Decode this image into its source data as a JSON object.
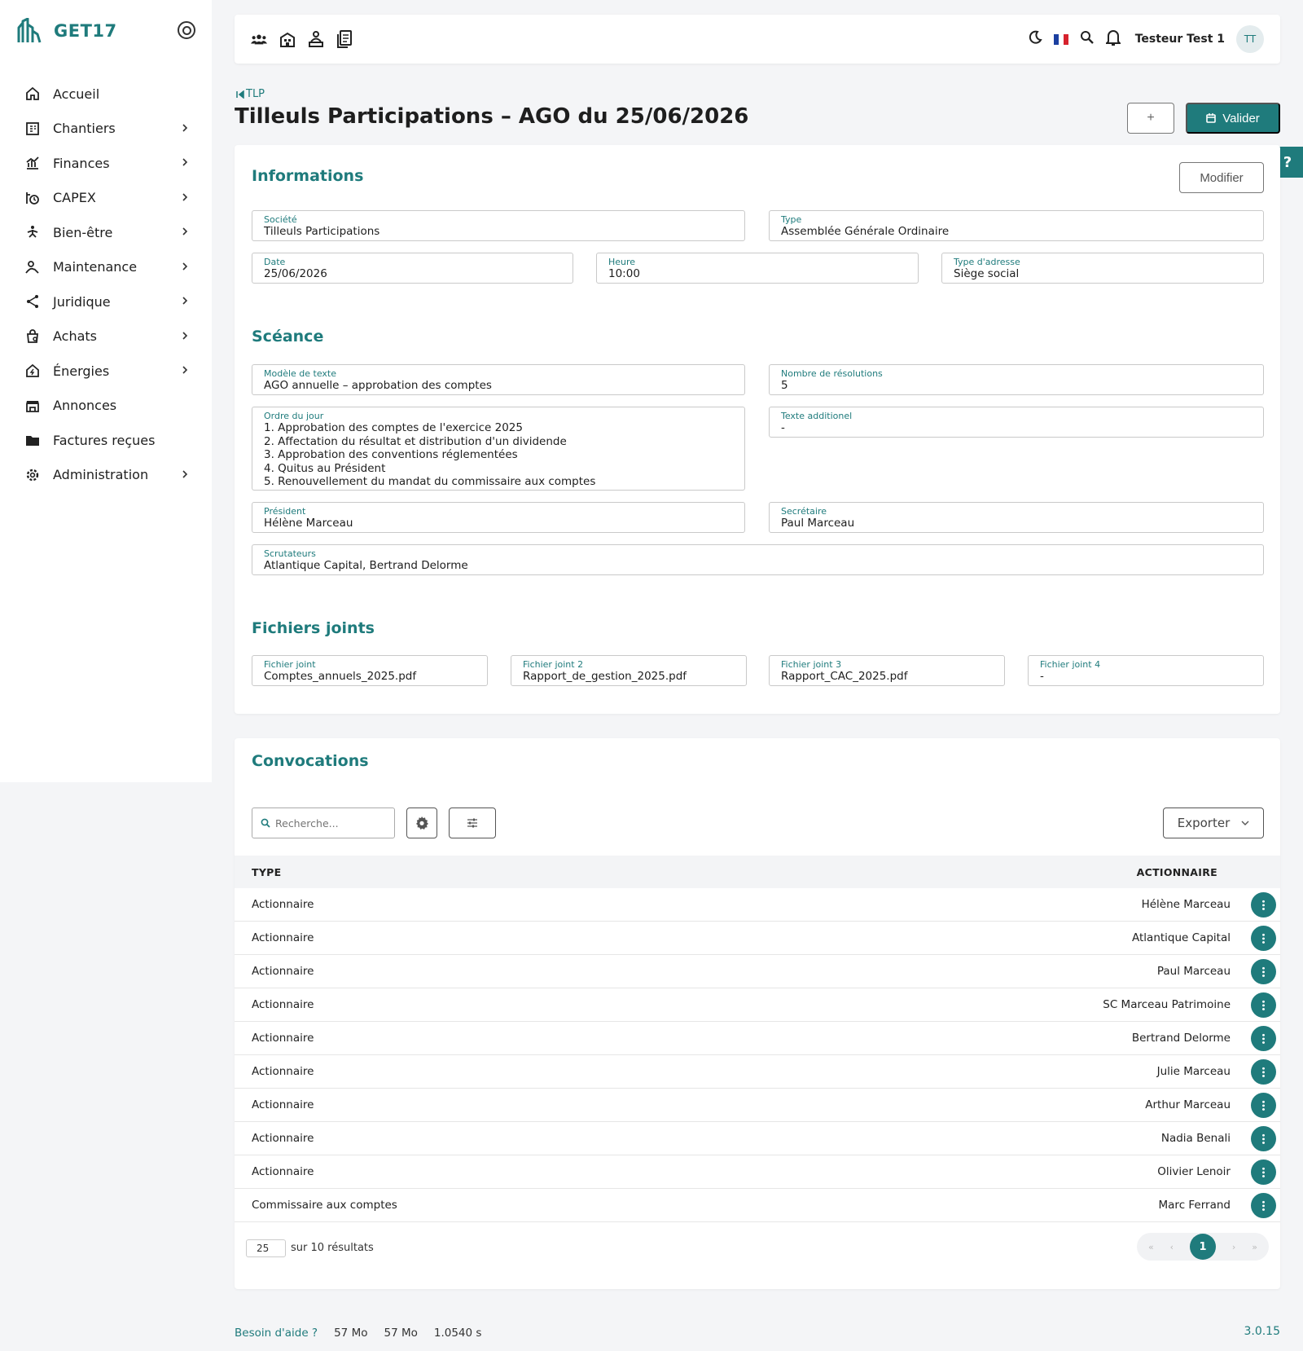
{
  "brand": {
    "name": "GET17"
  },
  "sidebar": {
    "items": [
      {
        "label": "Accueil",
        "icon": "home-icon",
        "chevron": false
      },
      {
        "label": "Chantiers",
        "icon": "building-plan-icon",
        "chevron": true
      },
      {
        "label": "Finances",
        "icon": "finance-chart-icon",
        "chevron": true
      },
      {
        "label": "CAPEX",
        "icon": "capex-icon",
        "chevron": true
      },
      {
        "label": "Bien-être",
        "icon": "wellness-icon",
        "chevron": true
      },
      {
        "label": "Maintenance",
        "icon": "maintenance-icon",
        "chevron": true
      },
      {
        "label": "Juridique",
        "icon": "share-icon",
        "chevron": true
      },
      {
        "label": "Achats",
        "icon": "shopping-icon",
        "chevron": true
      },
      {
        "label": "Énergies",
        "icon": "energy-home-icon",
        "chevron": true
      },
      {
        "label": "Annonces",
        "icon": "storefront-icon",
        "chevron": false
      },
      {
        "label": "Factures reçues",
        "icon": "folder-icon",
        "chevron": false
      },
      {
        "label": "Administration",
        "icon": "settings-icon",
        "chevron": true
      }
    ]
  },
  "topbar": {
    "user_name": "Testeur Test 1",
    "avatar_initials": "TT"
  },
  "breadcrumb": {
    "label": "TLP"
  },
  "page": {
    "title": "Tilleuls Participations – AGO du 25/06/2026",
    "plus_label": "+",
    "valider_label": "Valider",
    "help_label": "?"
  },
  "informations": {
    "title": "Informations",
    "modifier_label": "Modifier",
    "societe": {
      "label": "Société",
      "value": "Tilleuls Participations"
    },
    "type": {
      "label": "Type",
      "value": "Assemblée Générale Ordinaire"
    },
    "date": {
      "label": "Date",
      "value": "25/06/2026"
    },
    "heure": {
      "label": "Heure",
      "value": "10:00"
    },
    "type_adresse": {
      "label": "Type d'adresse",
      "value": "Siège social"
    }
  },
  "seance": {
    "title": "Scéance",
    "modele": {
      "label": "Modèle de texte",
      "value": "AGO annuelle – approbation des comptes"
    },
    "nb_resolutions": {
      "label": "Nombre de résolutions",
      "value": "5"
    },
    "ordre_du_jour": {
      "label": "Ordre du jour",
      "value": "1. Approbation des comptes de l'exercice 2025\n2. Affectation du résultat et distribution d'un dividende\n3. Approbation des conventions réglementées\n4. Quitus au Président\n5. Renouvellement du mandat du commissaire aux comptes"
    },
    "texte_additionnel": {
      "label": "Texte additionel",
      "value": "-"
    },
    "president": {
      "label": "Président",
      "value": "Hélène Marceau"
    },
    "secretaire": {
      "label": "Secrétaire",
      "value": "Paul Marceau"
    },
    "scrutateurs": {
      "label": "Scrutateurs",
      "value": "Atlantique Capital, Bertrand Delorme"
    }
  },
  "fichiers": {
    "title": "Fichiers joints",
    "items": [
      {
        "label": "Fichier joint",
        "value": "Comptes_annuels_2025.pdf"
      },
      {
        "label": "Fichier joint 2",
        "value": "Rapport_de_gestion_2025.pdf"
      },
      {
        "label": "Fichier joint 3",
        "value": "Rapport_CAC_2025.pdf"
      },
      {
        "label": "Fichier joint 4",
        "value": "-"
      }
    ]
  },
  "convocations": {
    "title": "Convocations",
    "search_placeholder": "Recherche...",
    "export_label": "Exporter",
    "columns": {
      "type": "TYPE",
      "actionnaire": "ACTIONNAIRE"
    },
    "rows": [
      {
        "type": "Actionnaire",
        "name": "Hélène Marceau"
      },
      {
        "type": "Actionnaire",
        "name": "Atlantique Capital"
      },
      {
        "type": "Actionnaire",
        "name": "Paul Marceau"
      },
      {
        "type": "Actionnaire",
        "name": "SC Marceau Patrimoine"
      },
      {
        "type": "Actionnaire",
        "name": "Bertrand Delorme"
      },
      {
        "type": "Actionnaire",
        "name": "Julie Marceau"
      },
      {
        "type": "Actionnaire",
        "name": "Arthur Marceau"
      },
      {
        "type": "Actionnaire",
        "name": "Nadia Benali"
      },
      {
        "type": "Actionnaire",
        "name": "Olivier Lenoir"
      },
      {
        "type": "Commissaire aux comptes",
        "name": "Marc Ferrand"
      }
    ],
    "per_page": "25",
    "results_text": "sur 10 résultats",
    "pager": {
      "first": "«",
      "prev": "‹",
      "current": "1",
      "next": "›",
      "last": "»"
    }
  },
  "footer": {
    "help": "Besoin d'aide ?",
    "mem1": "57 Mo",
    "mem2": "57 Mo",
    "time": "1.0540 s",
    "version": "3.0.15"
  },
  "colors": {
    "accent": "#1f7b7c",
    "flag_blue": "#1b3fa0",
    "flag_red": "#d6222d"
  }
}
